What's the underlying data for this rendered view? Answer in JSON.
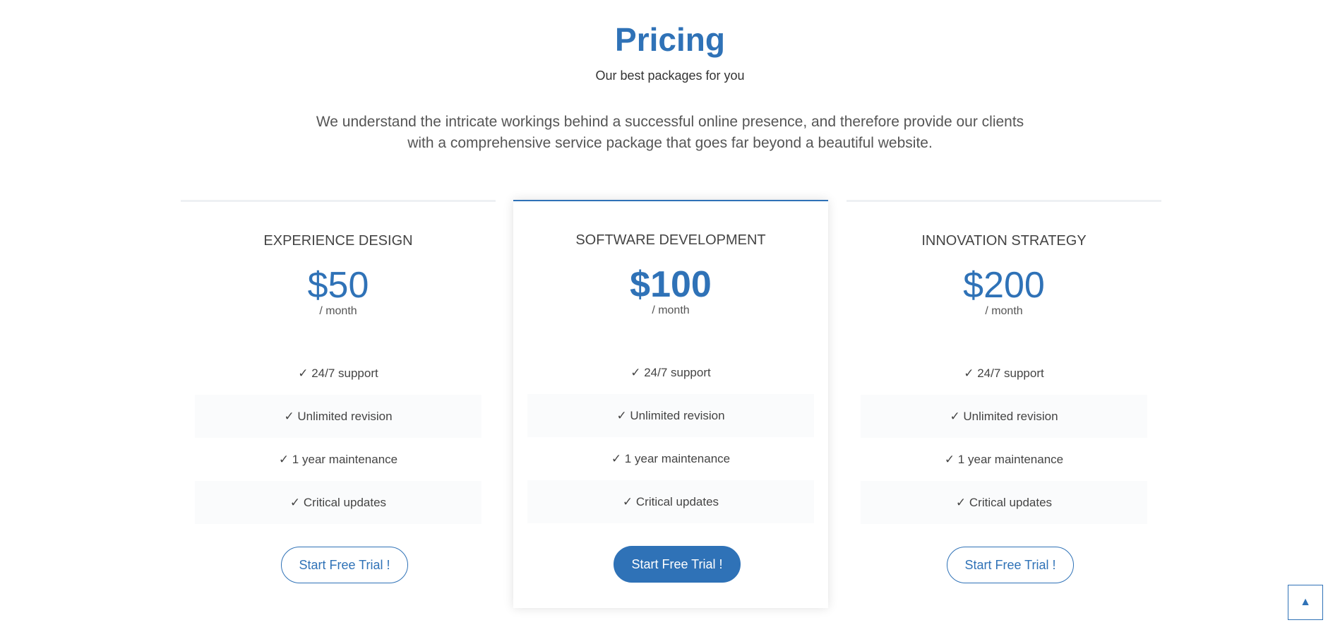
{
  "header": {
    "title": "Pricing",
    "subtitle": "Our best packages for you",
    "intro": "We understand the intricate workings behind a successful online presence, and therefore provide our clients with a comprehensive service package that goes far beyond a beautiful website."
  },
  "plans": [
    {
      "name": "EXPERIENCE DESIGN",
      "price": "$50",
      "period": "/ month",
      "features": [
        "✓ 24/7 support",
        "✓ Unlimited revision",
        "✓ 1 year maintenance",
        "✓ Critical updates"
      ],
      "button": "Start Free Trial !"
    },
    {
      "name": "SOFTWARE DEVELOPMENT",
      "price": "$100",
      "period": "/ month",
      "features": [
        "✓ 24/7 support",
        "✓ Unlimited revision",
        "✓ 1 year maintenance",
        "✓ Critical updates"
      ],
      "button": "Start Free Trial !"
    },
    {
      "name": "INNOVATION STRATEGY",
      "price": "$200",
      "period": "/ month",
      "features": [
        "✓ 24/7 support",
        "✓ Unlimited revision",
        "✓ 1 year maintenance",
        "✓ Critical updates"
      ],
      "button": "Start Free Trial !"
    }
  ],
  "scroll_top": {
    "icon": "arrow-up-icon",
    "glyph": "▲"
  },
  "colors": {
    "accent": "#2f72b7",
    "text": "#444444",
    "stripe": "#fafbfc"
  }
}
